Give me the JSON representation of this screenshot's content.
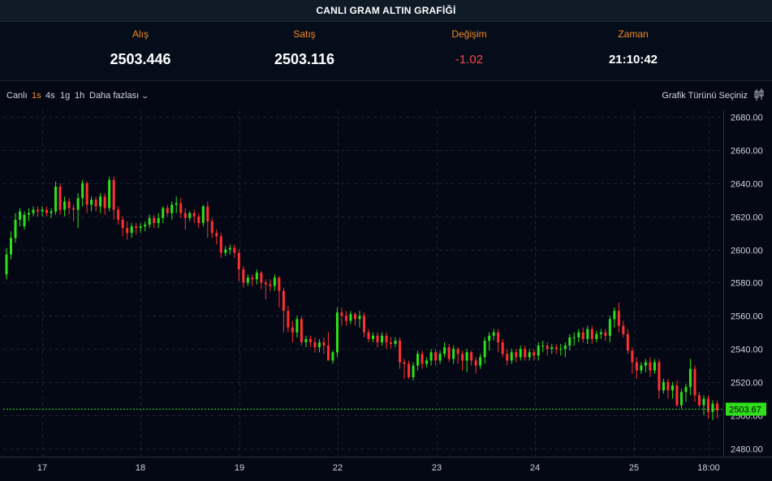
{
  "header": {
    "title": "CANLI GRAM ALTIN GRAFİĞİ"
  },
  "stats": {
    "bid_label": "Alış",
    "bid_value": "2503.446",
    "ask_label": "Satış",
    "ask_value": "2503.116",
    "change_label": "Değişim",
    "change_value": "-1.02",
    "time_label": "Zaman",
    "time_value": "21:10:42"
  },
  "colors": {
    "up": "#2ee01a",
    "down": "#ff3030",
    "accent": "#f08a24",
    "current_price": "#2ee01a"
  },
  "toolbar": {
    "live": "Canlı",
    "timeframes": [
      "1s",
      "4s",
      "1g",
      "1h"
    ],
    "active_timeframe": "1s",
    "more": "Daha fazlası",
    "chart_type": "Grafik Türünü Seçiniz",
    "chart_type_icon": "candlestick-icon",
    "more_icon": "chevron-down-icon"
  },
  "chart_data": {
    "type": "candlestick",
    "title": "",
    "ylim": [
      2475,
      2684
    ],
    "yticks": [
      "2680.00",
      "2660.00",
      "2640.00",
      "2620.00",
      "2600.00",
      "2580.00",
      "2560.00",
      "2540.00",
      "2520.00",
      "2500.00",
      "2480.00"
    ],
    "x_labels": [
      "17",
      "18",
      "19",
      "22",
      "23",
      "24",
      "25",
      "18:00"
    ],
    "current_price": "2503.67",
    "grid": true,
    "candles": [
      [
        2585,
        2597,
        2582,
        2601
      ],
      [
        2597,
        2607,
        2594,
        2611
      ],
      [
        2607,
        2618,
        2604,
        2622
      ],
      [
        2618,
        2623,
        2614,
        2625
      ],
      [
        2614,
        2621,
        2612,
        2623
      ],
      [
        2621,
        2622,
        2617,
        2625
      ],
      [
        2622,
        2624,
        2620,
        2626
      ],
      [
        2624,
        2623,
        2620,
        2626
      ],
      [
        2623,
        2624,
        2620,
        2626
      ],
      [
        2624,
        2622,
        2620,
        2626
      ],
      [
        2622,
        2623,
        2619,
        2625
      ],
      [
        2623,
        2638,
        2621,
        2641
      ],
      [
        2638,
        2624,
        2621,
        2640
      ],
      [
        2624,
        2629,
        2620,
        2632
      ],
      [
        2629,
        2625,
        2621,
        2631
      ],
      [
        2625,
        2624,
        2617,
        2627
      ],
      [
        2624,
        2631,
        2613,
        2634
      ],
      [
        2631,
        2640,
        2626,
        2642
      ],
      [
        2640,
        2627,
        2622,
        2641
      ],
      [
        2627,
        2630,
        2623,
        2632
      ],
      [
        2630,
        2626,
        2623,
        2632
      ],
      [
        2626,
        2632,
        2622,
        2634
      ],
      [
        2632,
        2625,
        2621,
        2634
      ],
      [
        2625,
        2642,
        2623,
        2644
      ],
      [
        2642,
        2624,
        2618,
        2644
      ],
      [
        2624,
        2618,
        2615,
        2626
      ],
      [
        2618,
        2613,
        2608,
        2620
      ],
      [
        2613,
        2610,
        2606,
        2617
      ],
      [
        2610,
        2614,
        2607,
        2616
      ],
      [
        2614,
        2613,
        2609,
        2616
      ],
      [
        2613,
        2614,
        2610,
        2616
      ],
      [
        2614,
        2615,
        2611,
        2617
      ],
      [
        2615,
        2619,
        2613,
        2621
      ],
      [
        2619,
        2616,
        2613,
        2621
      ],
      [
        2616,
        2619,
        2613,
        2622
      ],
      [
        2619,
        2625,
        2616,
        2626
      ],
      [
        2625,
        2622,
        2620,
        2627
      ],
      [
        2622,
        2627,
        2618,
        2629
      ],
      [
        2627,
        2628,
        2622,
        2632
      ],
      [
        2628,
        2622,
        2619,
        2631
      ],
      [
        2622,
        2619,
        2612,
        2625
      ],
      [
        2619,
        2622,
        2617,
        2623
      ],
      [
        2622,
        2620,
        2616,
        2624
      ],
      [
        2620,
        2616,
        2613,
        2622
      ],
      [
        2616,
        2626,
        2614,
        2627
      ],
      [
        2626,
        2617,
        2607,
        2629
      ],
      [
        2617,
        2610,
        2607,
        2619
      ],
      [
        2610,
        2608,
        2603,
        2612
      ],
      [
        2608,
        2598,
        2595,
        2610
      ],
      [
        2598,
        2600,
        2596,
        2602
      ],
      [
        2600,
        2601,
        2597,
        2603
      ],
      [
        2601,
        2598,
        2595,
        2603
      ],
      [
        2598,
        2588,
        2581,
        2600
      ],
      [
        2588,
        2580,
        2577,
        2590
      ],
      [
        2580,
        2583,
        2578,
        2585
      ],
      [
        2583,
        2582,
        2578,
        2585
      ],
      [
        2582,
        2586,
        2579,
        2588
      ],
      [
        2586,
        2580,
        2576,
        2587
      ],
      [
        2580,
        2579,
        2570,
        2582
      ],
      [
        2579,
        2578,
        2575,
        2582
      ],
      [
        2578,
        2583,
        2575,
        2585
      ],
      [
        2583,
        2575,
        2565,
        2584
      ],
      [
        2575,
        2563,
        2550,
        2577
      ],
      [
        2563,
        2553,
        2550,
        2566
      ],
      [
        2553,
        2550,
        2544,
        2557
      ],
      [
        2550,
        2558,
        2547,
        2560
      ],
      [
        2558,
        2544,
        2542,
        2560
      ],
      [
        2544,
        2546,
        2541,
        2548
      ],
      [
        2546,
        2544,
        2541,
        2548
      ],
      [
        2544,
        2541,
        2538,
        2547
      ],
      [
        2541,
        2544,
        2538,
        2546
      ],
      [
        2544,
        2542,
        2537,
        2547
      ],
      [
        2542,
        2533,
        2533,
        2550
      ],
      [
        2533,
        2538,
        2531,
        2539
      ],
      [
        2538,
        2562,
        2535,
        2565
      ],
      [
        2562,
        2560,
        2554,
        2565
      ],
      [
        2560,
        2557,
        2554,
        2563
      ],
      [
        2557,
        2561,
        2555,
        2563
      ],
      [
        2561,
        2558,
        2554,
        2562
      ],
      [
        2558,
        2560,
        2553,
        2563
      ],
      [
        2560,
        2550,
        2547,
        2562
      ],
      [
        2550,
        2546,
        2544,
        2552
      ],
      [
        2546,
        2548,
        2544,
        2550
      ],
      [
        2548,
        2544,
        2541,
        2550
      ],
      [
        2544,
        2548,
        2542,
        2550
      ],
      [
        2548,
        2544,
        2540,
        2550
      ],
      [
        2544,
        2543,
        2540,
        2547
      ],
      [
        2543,
        2545,
        2541,
        2547
      ],
      [
        2545,
        2532,
        2528,
        2547
      ],
      [
        2532,
        2531,
        2522,
        2534
      ],
      [
        2531,
        2523,
        2522,
        2533
      ],
      [
        2523,
        2530,
        2521,
        2532
      ],
      [
        2530,
        2537,
        2527,
        2539
      ],
      [
        2537,
        2531,
        2528,
        2539
      ],
      [
        2531,
        2533,
        2529,
        2535
      ],
      [
        2533,
        2538,
        2530,
        2540
      ],
      [
        2538,
        2533,
        2530,
        2540
      ],
      [
        2533,
        2537,
        2531,
        2539
      ],
      [
        2537,
        2541,
        2535,
        2544
      ],
      [
        2541,
        2534,
        2532,
        2543
      ],
      [
        2534,
        2540,
        2531,
        2542
      ],
      [
        2540,
        2537,
        2531,
        2541
      ],
      [
        2537,
        2533,
        2527,
        2539
      ],
      [
        2533,
        2538,
        2526,
        2540
      ],
      [
        2538,
        2533,
        2530,
        2539
      ],
      [
        2533,
        2530,
        2525,
        2535
      ],
      [
        2530,
        2535,
        2528,
        2537
      ],
      [
        2535,
        2545,
        2531,
        2547
      ],
      [
        2545,
        2548,
        2539,
        2550
      ],
      [
        2548,
        2550,
        2545,
        2552
      ],
      [
        2550,
        2544,
        2538,
        2552
      ],
      [
        2544,
        2537,
        2535,
        2546
      ],
      [
        2537,
        2533,
        2530,
        2540
      ],
      [
        2533,
        2538,
        2531,
        2540
      ],
      [
        2538,
        2535,
        2532,
        2540
      ],
      [
        2535,
        2540,
        2533,
        2542
      ],
      [
        2540,
        2535,
        2533,
        2542
      ],
      [
        2535,
        2538,
        2533,
        2540
      ],
      [
        2538,
        2536,
        2533,
        2540
      ],
      [
        2536,
        2542,
        2533,
        2544
      ],
      [
        2542,
        2542,
        2538,
        2545
      ],
      [
        2542,
        2540,
        2536,
        2544
      ],
      [
        2540,
        2541,
        2537,
        2543
      ],
      [
        2541,
        2540,
        2537,
        2543
      ],
      [
        2540,
        2540,
        2536,
        2543
      ],
      [
        2540,
        2542,
        2535,
        2544
      ],
      [
        2542,
        2547,
        2539,
        2549
      ],
      [
        2547,
        2547,
        2542,
        2550
      ],
      [
        2547,
        2550,
        2544,
        2552
      ],
      [
        2550,
        2546,
        2544,
        2553
      ],
      [
        2546,
        2552,
        2543,
        2554
      ],
      [
        2552,
        2546,
        2543,
        2554
      ],
      [
        2546,
        2549,
        2544,
        2551
      ],
      [
        2549,
        2550,
        2546,
        2552
      ],
      [
        2550,
        2548,
        2545,
        2552
      ],
      [
        2548,
        2558,
        2544,
        2560
      ],
      [
        2558,
        2563,
        2553,
        2565
      ],
      [
        2563,
        2554,
        2550,
        2568
      ],
      [
        2554,
        2549,
        2547,
        2557
      ],
      [
        2549,
        2539,
        2537,
        2552
      ],
      [
        2539,
        2532,
        2525,
        2541
      ],
      [
        2532,
        2527,
        2522,
        2535
      ],
      [
        2527,
        2530,
        2525,
        2532
      ],
      [
        2530,
        2532,
        2526,
        2534
      ],
      [
        2532,
        2527,
        2523,
        2535
      ],
      [
        2527,
        2532,
        2525,
        2534
      ],
      [
        2532,
        2515,
        2510,
        2534
      ],
      [
        2515,
        2520,
        2513,
        2522
      ],
      [
        2520,
        2515,
        2510,
        2522
      ],
      [
        2515,
        2518,
        2510,
        2520
      ],
      [
        2518,
        2506,
        2505,
        2521
      ],
      [
        2506,
        2514,
        2504,
        2516
      ],
      [
        2514,
        2517,
        2508,
        2519
      ],
      [
        2517,
        2528,
        2512,
        2534
      ],
      [
        2528,
        2512,
        2508,
        2530
      ],
      [
        2512,
        2506,
        2505,
        2514
      ],
      [
        2506,
        2510,
        2500,
        2512
      ],
      [
        2510,
        2502,
        2498,
        2512
      ],
      [
        2502,
        2507,
        2497,
        2509
      ],
      [
        2507,
        2503,
        2498,
        2509
      ]
    ]
  }
}
